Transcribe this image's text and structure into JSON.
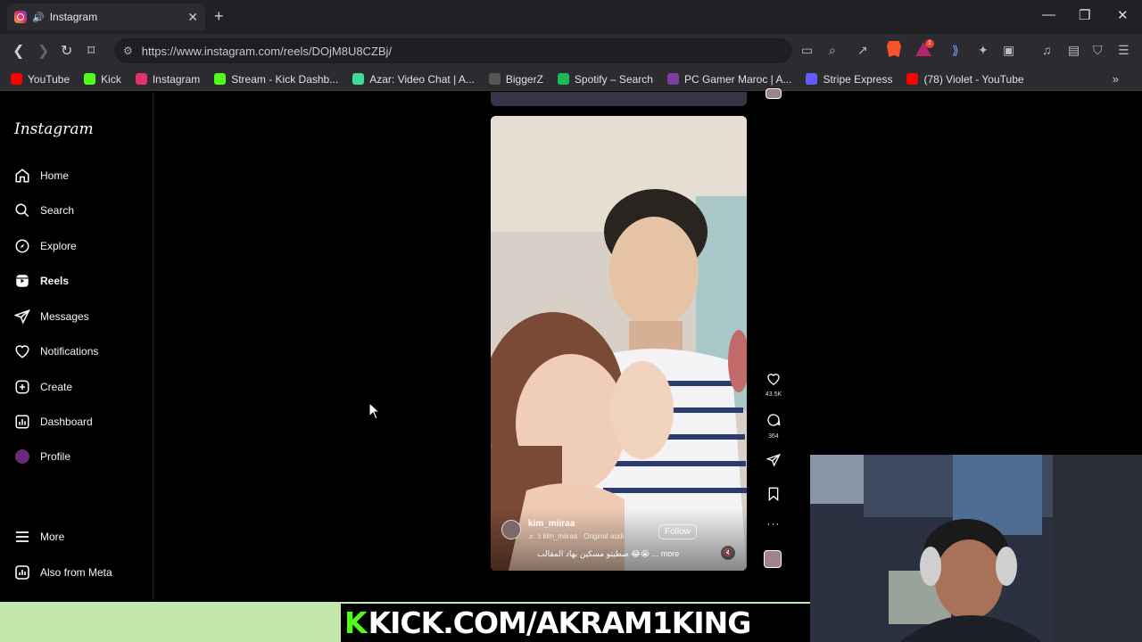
{
  "browser": {
    "tab_title": "Instagram",
    "url": "https://www.instagram.com/reels/DOjM8U8CZBj/",
    "rewards_badge": "1",
    "bookmarks": [
      {
        "label": "YouTube",
        "color": "#ff0000"
      },
      {
        "label": "Kick",
        "color": "#53fc18"
      },
      {
        "label": "Instagram",
        "color": "#e1306c"
      },
      {
        "label": "Stream - Kick Dashb...",
        "color": "#53fc18"
      },
      {
        "label": "Azar: Video Chat | A...",
        "color": "#3ddc97"
      },
      {
        "label": "BiggerZ",
        "color": "#555555"
      },
      {
        "label": "Spotify – Search",
        "color": "#1db954"
      },
      {
        "label": "PC Gamer Maroc | A...",
        "color": "#7a3fa0"
      },
      {
        "label": "Stripe Express",
        "color": "#635bff"
      },
      {
        "label": "(78) Violet - YouTube",
        "color": "#ff0000"
      }
    ]
  },
  "instagram": {
    "logo": "Instagram",
    "nav": [
      {
        "label": "Home",
        "icon": "home-icon"
      },
      {
        "label": "Search",
        "icon": "search-icon"
      },
      {
        "label": "Explore",
        "icon": "compass-icon"
      },
      {
        "label": "Reels",
        "icon": "reels-icon",
        "active": true
      },
      {
        "label": "Messages",
        "icon": "messages-icon"
      },
      {
        "label": "Notifications",
        "icon": "heart-icon"
      },
      {
        "label": "Create",
        "icon": "plus-icon"
      },
      {
        "label": "Dashboard",
        "icon": "dashboard-icon"
      },
      {
        "label": "Profile",
        "icon": "avatar"
      }
    ],
    "more_label": "More",
    "meta_label": "Also from Meta",
    "reel": {
      "username": "kim_miiraa",
      "audio": "♬ ɔ kim_miiraa · Original audi",
      "follow_label": "Follow",
      "caption": "صطيتو مسكين بهاد المقالب 😂😭 ... more",
      "likes": "43.5K",
      "comments": "364"
    }
  },
  "overlay": {
    "kick_url": "KICK.COM/AKRAM1KING",
    "kick_k": "K"
  }
}
